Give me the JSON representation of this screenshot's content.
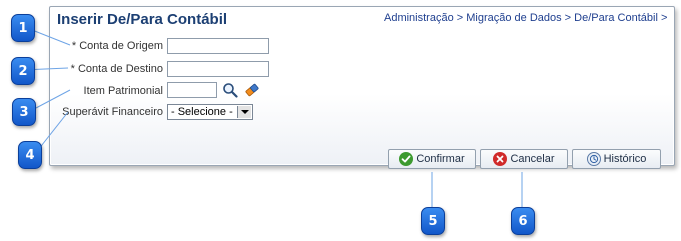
{
  "form": {
    "title": "Inserir De/Para Contábil",
    "breadcrumb": "Administração > Migração de Dados > De/Para Contábil >",
    "fields": {
      "conta_origem_label": "* Conta de Origem",
      "conta_origem_value": "",
      "conta_destino_label": "* Conta de Destino",
      "conta_destino_value": "",
      "item_patrimonial_label": "Item Patrimonial",
      "item_patrimonial_value": "",
      "superavit_label": "Superávit Financeiro",
      "superavit_selected": "- Selecione -"
    },
    "buttons": {
      "confirmar": "Confirmar",
      "cancelar": "Cancelar",
      "historico": "Histórico"
    }
  },
  "callouts": [
    "1",
    "2",
    "3",
    "4",
    "5",
    "6"
  ],
  "colors": {
    "title": "#1c3f73",
    "breadcrumb": "#1f3f8f",
    "badge": "#1a6ae0",
    "confirm_icon": "#3c9a2f",
    "cancel_icon": "#d02a2a"
  },
  "icons": {
    "search": "search-icon",
    "eraser": "eraser-icon",
    "confirm": "checkmark-icon",
    "cancel": "close-icon",
    "history": "history-icon"
  }
}
